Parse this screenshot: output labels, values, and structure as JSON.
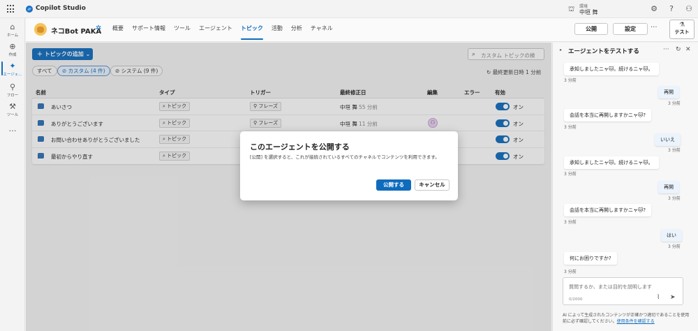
{
  "app": {
    "brand": "Copilot Studio",
    "env_label": "環境",
    "user": "中垣 舞"
  },
  "nav": [
    {
      "label": "ホーム",
      "icon": "⌂"
    },
    {
      "label": "作成",
      "icon": "⊕"
    },
    {
      "label": "エージェ...",
      "icon": "✦"
    },
    {
      "label": "フロー",
      "icon": "⚲"
    },
    {
      "label": "ツール",
      "icon": "⚒"
    },
    {
      "label": "",
      "icon": "…"
    }
  ],
  "agent": {
    "name": "ネコBot PAKA",
    "tabs": [
      "概要",
      "サポート情報",
      "ツール",
      "エージェント",
      "トピック",
      "活動",
      "分析",
      "チャネル"
    ],
    "active_tab": "トピック",
    "publish": "公開",
    "settings": "設定",
    "more": "···",
    "test": "テスト"
  },
  "topics": {
    "add_button": "＋ トピックの追加 ⌄",
    "search_placeholder": "カスタム トピックの検",
    "filters": [
      "すべて",
      "カスタム (4 件)",
      "システム (9 件)"
    ],
    "last_updated": "最終更新日時 1 分前",
    "columns": [
      "名前",
      "タイプ",
      "トリガー",
      "最終修正日",
      "編集",
      "エラー",
      "有効"
    ],
    "rows": [
      {
        "name": "あいさつ",
        "type": "トピック",
        "trigger": "フレーズ",
        "modified_by": "中垣 舞",
        "modified_ago": "55 分前",
        "enabled": "オン"
      },
      {
        "name": "ありがとうございます",
        "type": "トピック",
        "trigger": "フレーズ",
        "modified_by": "中垣 舞",
        "modified_ago": "11 分前",
        "enabled": "オン"
      },
      {
        "name": "お問い合わせありがとうございました",
        "type": "トピック",
        "trigger": "",
        "modified_by": "",
        "modified_ago": "",
        "enabled": "オン"
      },
      {
        "name": "最初からやり直す",
        "type": "トピック",
        "trigger": "",
        "modified_by": "",
        "modified_ago": "",
        "enabled": "オン"
      }
    ]
  },
  "dialog": {
    "title": "このエージェントを公開する",
    "body": "[公開] を選択すると、これが接続されているすべてのチャネルでコンテンツを利用できます。",
    "primary": "公開する",
    "cancel": "キャンセル"
  },
  "test_panel": {
    "title": "エージェントをテストする",
    "messages": [
      {
        "from": "bot",
        "text": "承知しましたニャ🐱。続けるニャ🐱。",
        "time": "3 分前"
      },
      {
        "from": "user",
        "text": "再開",
        "time": "3 分前"
      },
      {
        "from": "bot",
        "text": "会話を本当に再開しますかニャ🐱?",
        "time": "3 分前"
      },
      {
        "from": "user",
        "text": "いいえ",
        "time": "3 分前"
      },
      {
        "from": "bot",
        "text": "承知しましたニャ🐱。続けるニャ🐱。",
        "time": "3 分前"
      },
      {
        "from": "user",
        "text": "再開",
        "time": "3 分前"
      },
      {
        "from": "bot",
        "text": "会話を本当に再開しますかニャ🐱?",
        "time": "3 分前"
      },
      {
        "from": "user",
        "text": "はい",
        "time": "3 分前"
      },
      {
        "from": "bot",
        "text": "何にお困りですか?",
        "time": "3 分前"
      }
    ],
    "composer_placeholder": "質問するか、または目的を説明します",
    "char_count": "0/2000",
    "disclaimer": "AI によって生成されたコンテンツが正確かつ適切であることを使用前に必ず確認してください。",
    "disclaimer_link": "使用条件を確認する"
  }
}
